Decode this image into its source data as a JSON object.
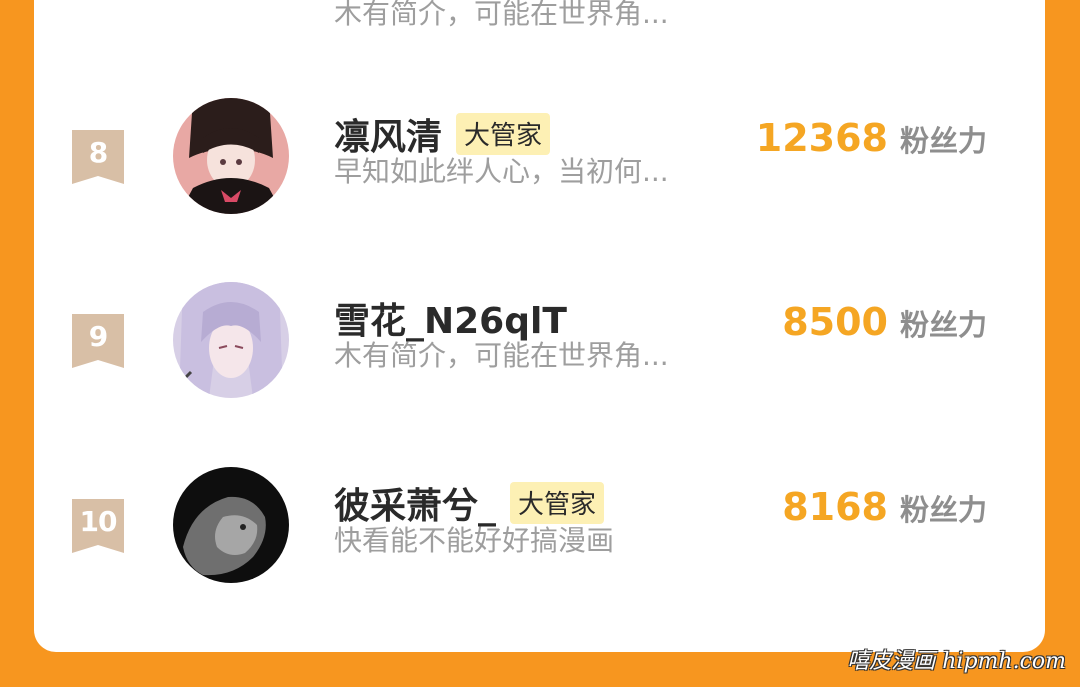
{
  "top_partial": {
    "bio": "木有简介，可能在世界角..."
  },
  "rows": [
    {
      "rank": "8",
      "name": "凛风清",
      "badge": "大管家",
      "bio": "早知如此绊人心，当初何...",
      "fans": "12368",
      "fans_label": "粉丝力"
    },
    {
      "rank": "9",
      "name": "雪花_N26qlT",
      "badge": "",
      "bio": "木有简介，可能在世界角...",
      "fans": "8500",
      "fans_label": "粉丝力"
    },
    {
      "rank": "10",
      "name": "彼采萧兮_",
      "badge": "大管家",
      "bio": "快看能不能好好搞漫画",
      "fans": "8168",
      "fans_label": "粉丝力"
    }
  ],
  "colors": {
    "background": "#f7961f",
    "fans_number": "#f5a623",
    "badge_bg": "#fdf0b4",
    "rank_ribbon": "#d8bfa6"
  },
  "watermark": "嘻皮漫画 hipmh.com"
}
